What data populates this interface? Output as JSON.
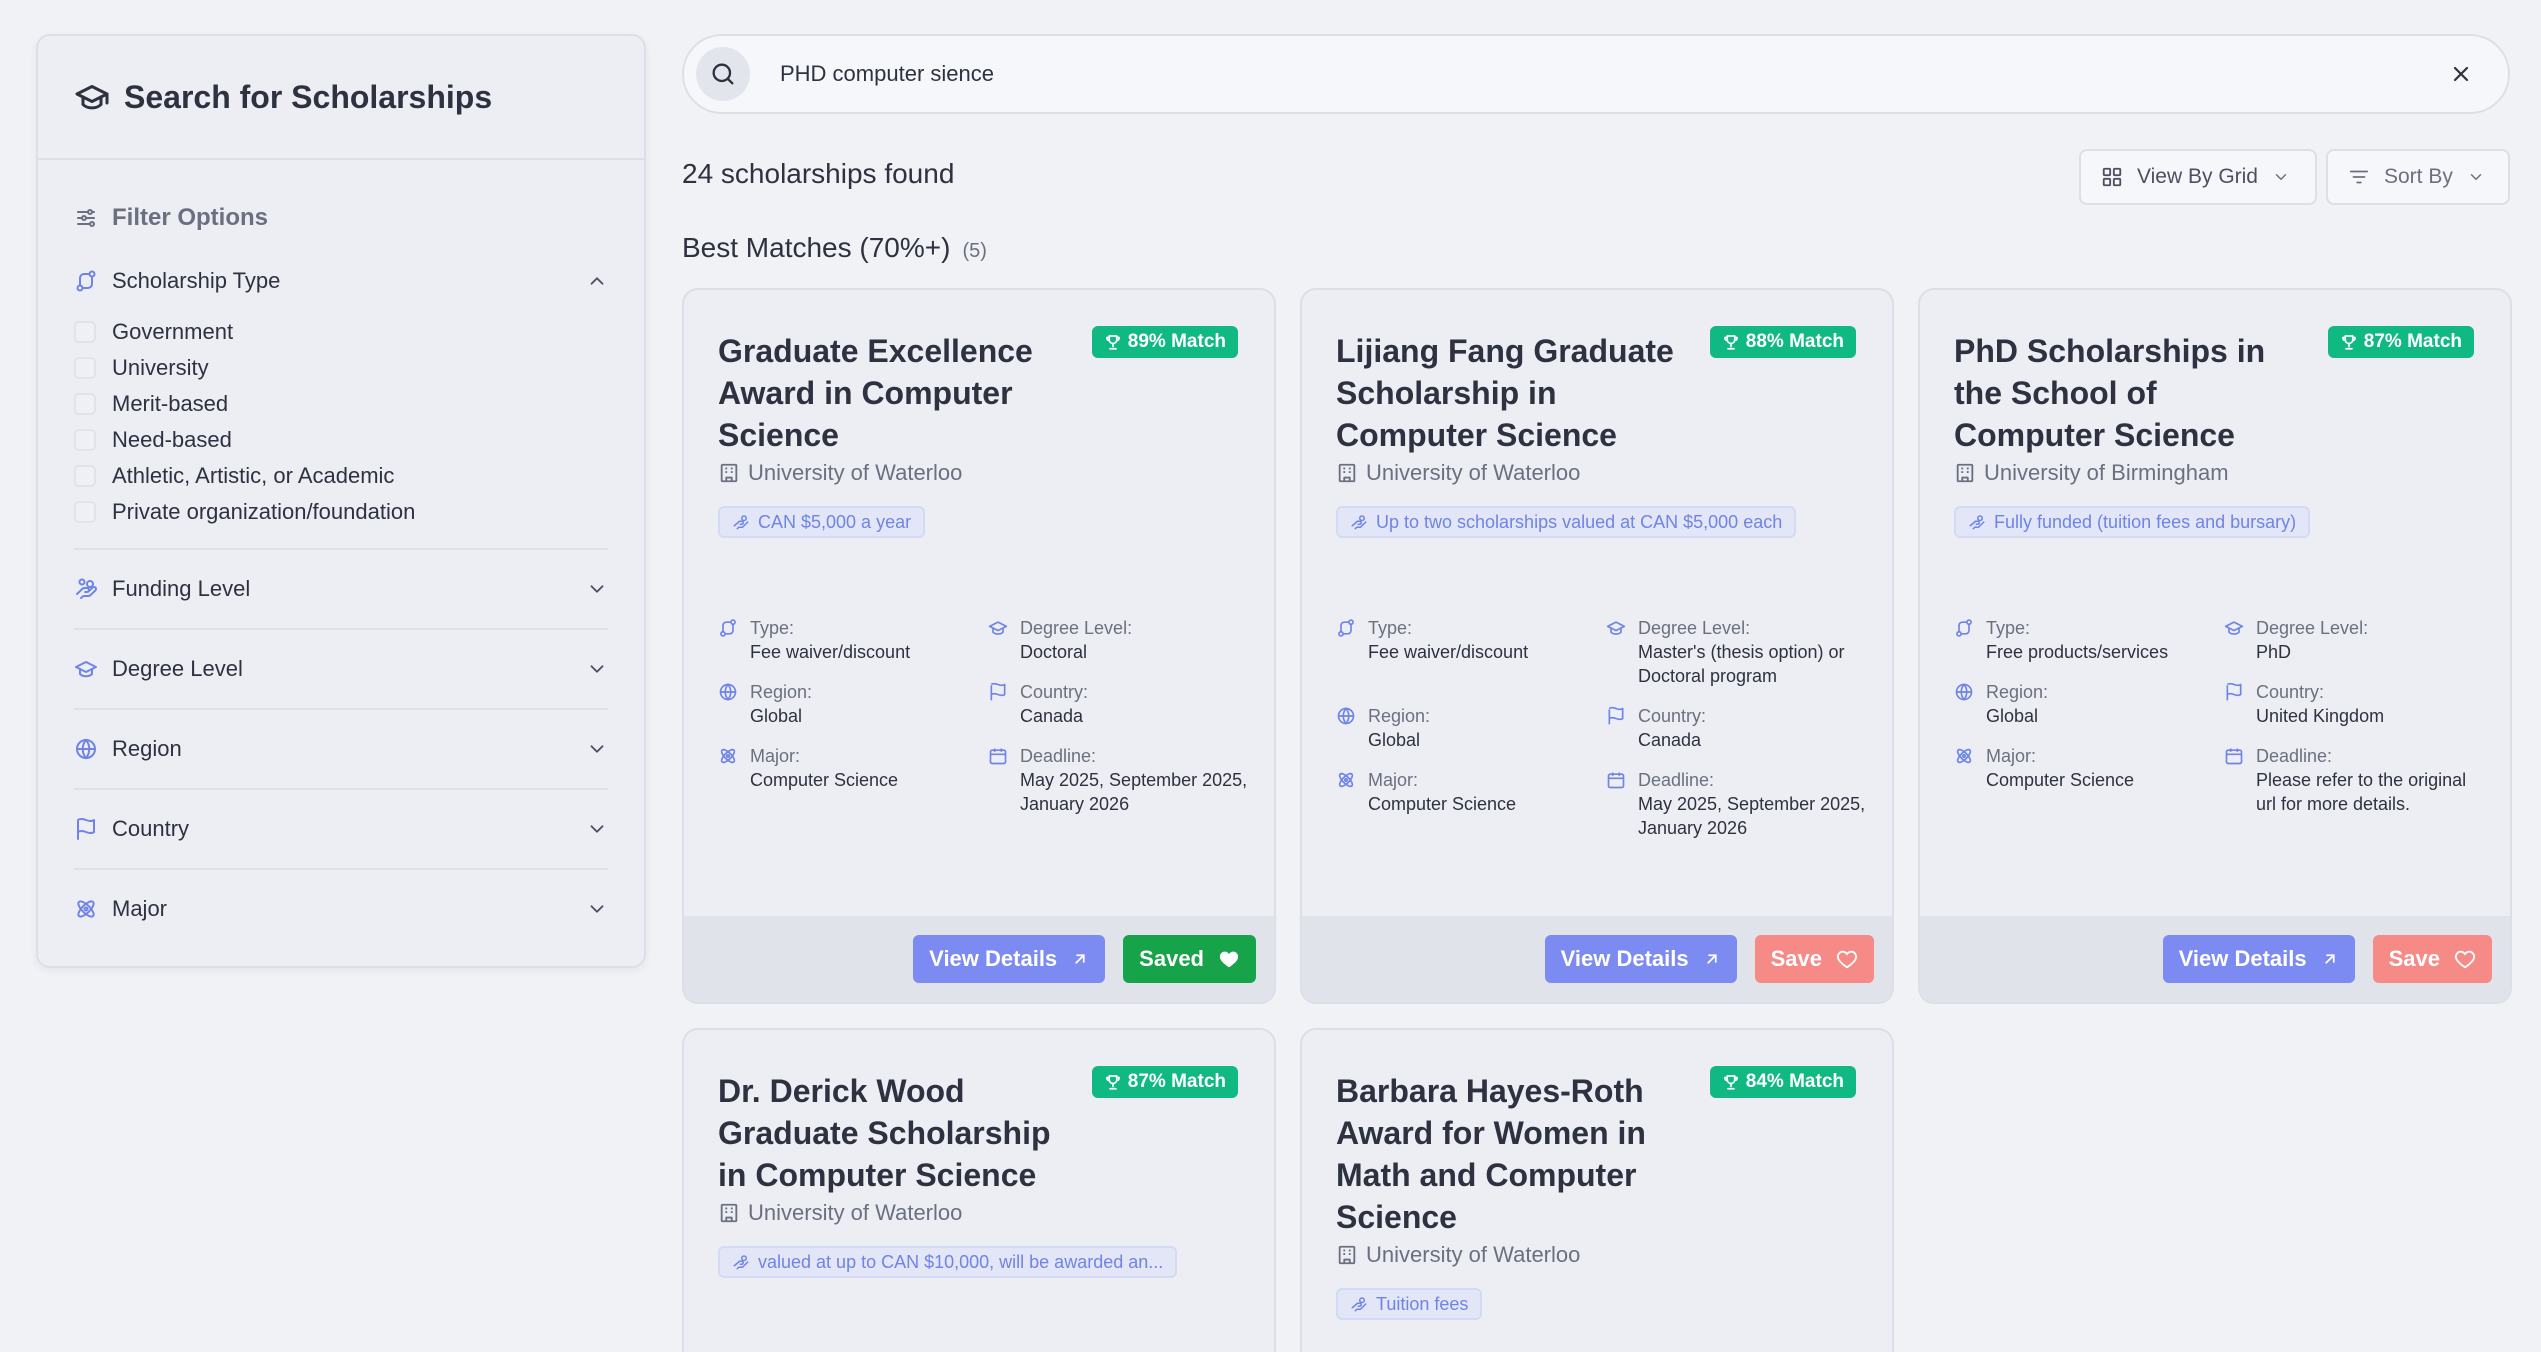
{
  "sidebar": {
    "title": "Search for Scholarships",
    "filter_options_label": "Filter Options",
    "sections": [
      {
        "label": "Scholarship Type",
        "expanded": true,
        "options": [
          "Government",
          "University",
          "Merit-based",
          "Need-based",
          "Athletic, Artistic, or Academic",
          "Private organization/foundation"
        ]
      },
      {
        "label": "Funding Level",
        "expanded": false
      },
      {
        "label": "Degree Level",
        "expanded": false
      },
      {
        "label": "Region",
        "expanded": false
      },
      {
        "label": "Country",
        "expanded": false
      },
      {
        "label": "Major",
        "expanded": false
      }
    ]
  },
  "search": {
    "value": "PHD computer sience"
  },
  "results": {
    "count_text": "24 scholarships found"
  },
  "toolbar": {
    "view_label": "View By Grid",
    "sort_label": "Sort By"
  },
  "best_matches": {
    "title": "Best Matches (70%+)",
    "count": "(5)"
  },
  "detail_labels": {
    "type": "Type:",
    "degree": "Degree Level:",
    "region": "Region:",
    "country": "Country:",
    "major": "Major:",
    "deadline": "Deadline:"
  },
  "cards": [
    {
      "title": "Graduate Excellence Award in Computer Science",
      "match": "89% Match",
      "institution": "University of Waterloo",
      "funding": "CAN $5,000 a year",
      "type": "Fee waiver/discount",
      "degree": "Doctoral",
      "region": "Global",
      "country": "Canada",
      "major": "Computer Science",
      "deadline": "May 2025, September 2025, January 2026",
      "view_label": "View Details",
      "save_label": "Saved",
      "saved": true
    },
    {
      "title": "Lijiang Fang Graduate Scholarship in Computer Science",
      "match": "88% Match",
      "institution": "University of Waterloo",
      "funding": "Up to two scholarships valued at CAN $5,000 each",
      "type": "Fee waiver/discount",
      "degree": "Master's (thesis option) or Doctoral program",
      "region": "Global",
      "country": "Canada",
      "major": "Computer Science",
      "deadline": "May 2025, September 2025, January 2026",
      "view_label": "View Details",
      "save_label": "Save",
      "saved": false
    },
    {
      "title": "PhD Scholarships in the School of Computer Science",
      "match": "87% Match",
      "institution": "University of Birmingham",
      "funding": "Fully funded (tuition fees and bursary)",
      "type": "Free products/services",
      "degree": "PhD",
      "region": "Global",
      "country": "United Kingdom",
      "major": "Computer Science",
      "deadline": "Please refer to the original url for more details.",
      "view_label": "View Details",
      "save_label": "Save",
      "saved": false
    },
    {
      "title": "Dr. Derick Wood Graduate Scholarship in Computer Science",
      "match": "87% Match",
      "institution": "University of Waterloo",
      "funding": "valued at up to CAN $10,000, will be awarded an..."
    },
    {
      "title": "Barbara Hayes-Roth Award for Women in Math and Computer Science",
      "match": "84% Match",
      "institution": "University of Waterloo",
      "funding": "Tuition fees"
    }
  ],
  "colors": {
    "match_badge": "#10b981",
    "view_button": "#7b8bf2",
    "saved_button": "#16a34a",
    "save_button": "#f58a87",
    "funding_text": "#6f84e6"
  }
}
